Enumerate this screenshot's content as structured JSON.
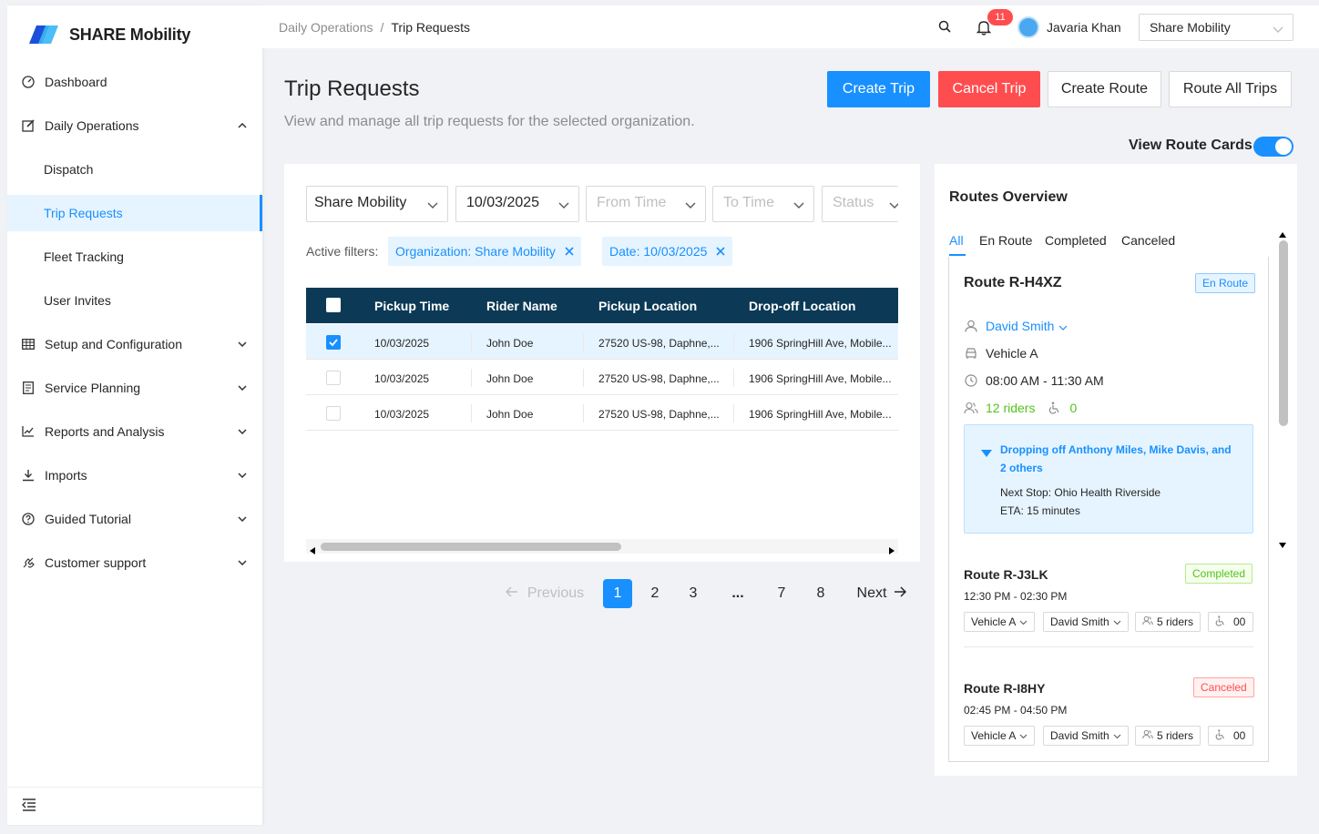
{
  "brand": {
    "name": "SHARE Mobility"
  },
  "sidebar": {
    "items": [
      {
        "label": "Dashboard",
        "icon": "dashboard-icon"
      },
      {
        "label": "Daily Operations",
        "icon": "edit-icon",
        "expanded": true
      },
      {
        "label": "Dispatch"
      },
      {
        "label": "Trip Requests",
        "active": true
      },
      {
        "label": "Fleet Tracking"
      },
      {
        "label": "User Invites"
      },
      {
        "label": "Setup and Configuration",
        "icon": "table-icon"
      },
      {
        "label": "Service Planning",
        "icon": "file-icon"
      },
      {
        "label": "Reports and Analysis",
        "icon": "line-chart-icon"
      },
      {
        "label": "Imports",
        "icon": "download-icon"
      },
      {
        "label": "Guided Tutorial",
        "icon": "question-circle-icon"
      },
      {
        "label": "Customer support",
        "icon": "phone-icon"
      }
    ]
  },
  "header": {
    "breadcrumb": [
      "Daily Operations",
      "Trip Requests"
    ],
    "notifications": "11",
    "user": "Javaria Khan",
    "org_select": "Share Mobility"
  },
  "page": {
    "title": "Trip Requests",
    "subtitle": "View and manage all trip requests for the selected organization.",
    "buttons": {
      "create_trip": "Create Trip",
      "cancel_trip": "Cancel Trip",
      "create_route": "Create Route",
      "route_all": "Route All Trips"
    },
    "toggle_label": "View Route Cards",
    "toggle_on": true
  },
  "filters": {
    "organization": "Share Mobility",
    "date": "10/03/2025",
    "from_time_placeholder": "From Time",
    "to_time_placeholder": "To Time",
    "status_placeholder": "Status",
    "active_label": "Active filters:",
    "tags": [
      "Organization: Share Mobility",
      "Date: 10/03/2025"
    ]
  },
  "table": {
    "columns": [
      "Pickup Time",
      "Rider Name",
      "Pickup Location",
      "Drop-off Location"
    ],
    "rows": [
      {
        "checked": true,
        "pickup_time": "10/03/2025",
        "rider": "John Doe",
        "pickup": "27520 US-98, Daphne,...",
        "dropoff": "1906 SpringHill Ave, Mobile..."
      },
      {
        "checked": false,
        "pickup_time": "10/03/2025",
        "rider": "John Doe",
        "pickup": "27520 US-98, Daphne,...",
        "dropoff": "1906 SpringHill Ave, Mobile..."
      },
      {
        "checked": false,
        "pickup_time": "10/03/2025",
        "rider": "John Doe",
        "pickup": "27520 US-98, Daphne,...",
        "dropoff": "1906 SpringHill Ave, Mobile..."
      }
    ]
  },
  "pagination": {
    "previous": "Previous",
    "next": "Next",
    "pages": [
      "1",
      "2",
      "3",
      "...",
      "7",
      "8"
    ],
    "current": "1"
  },
  "routes": {
    "title": "Routes Overview",
    "tabs": [
      "All",
      "En Route",
      "Completed",
      "Canceled"
    ],
    "active_tab": "All",
    "cards": [
      {
        "name": "Route R-H4XZ",
        "status": "En Route",
        "driver": "David Smith",
        "vehicle": "Vehicle A",
        "time": "08:00 AM - 11:30 AM",
        "riders": "12 riders",
        "wheelchair": "0",
        "info_head": "Dropping off Anthony Miles, Mike Davis, and 2 others",
        "next_stop": "Next Stop: Ohio Health Riverside",
        "eta": "ETA: 15 minutes"
      },
      {
        "name": "Route R-J3LK",
        "status": "Completed",
        "time": "12:30 PM - 02:30 PM",
        "vehicle": "Vehicle A",
        "driver": "David Smith",
        "riders": "5 riders",
        "wheelchair": "00"
      },
      {
        "name": "Route R-I8HY",
        "status": "Canceled",
        "time": "02:45 PM - 04:50 PM",
        "vehicle": "Vehicle A",
        "driver": "David Smith",
        "riders": "5 riders",
        "wheelchair": "00"
      }
    ]
  },
  "colors": {
    "primary": "#1890ff",
    "danger": "#ff4d4f",
    "table_header": "#0c3a56",
    "success": "#52c41a"
  }
}
